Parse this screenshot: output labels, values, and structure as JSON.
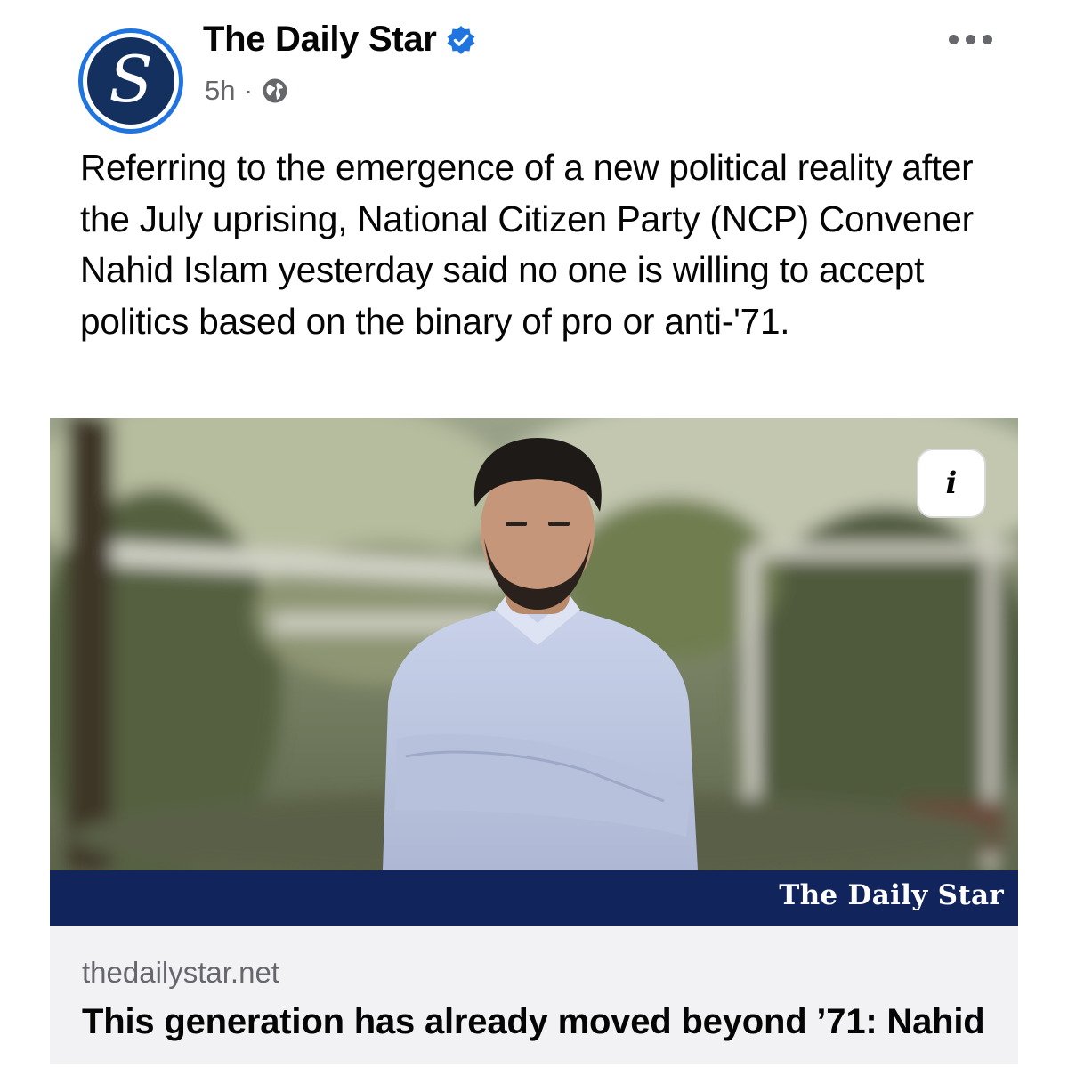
{
  "post": {
    "page_name": "The Daily Star",
    "avatar_letter": "S",
    "time_ago": "5h",
    "separator": "·",
    "caption": "Referring to the emergence of a new political reality after the July uprising, National Citizen Party (NCP) Convener Nahid Islam yesterday said no one is willing to accept politics based on the binary of pro or anti-'71.",
    "icons": {
      "verified": "verified-badge-icon",
      "audience": "globe-icon",
      "more": "more-options-icon",
      "info": "info-icon"
    }
  },
  "photo": {
    "info_label": "i",
    "banner_text": "The Daily Star"
  },
  "link_preview": {
    "domain": "thedailystar.net",
    "title": "This generation has already moved beyond ’71: Nahid"
  },
  "colors": {
    "brand_blue": "#1f74e0",
    "navy": "#14305e",
    "banner_navy": "#12245c",
    "secondary_text": "#65676b",
    "link_bg": "#f2f2f4"
  }
}
